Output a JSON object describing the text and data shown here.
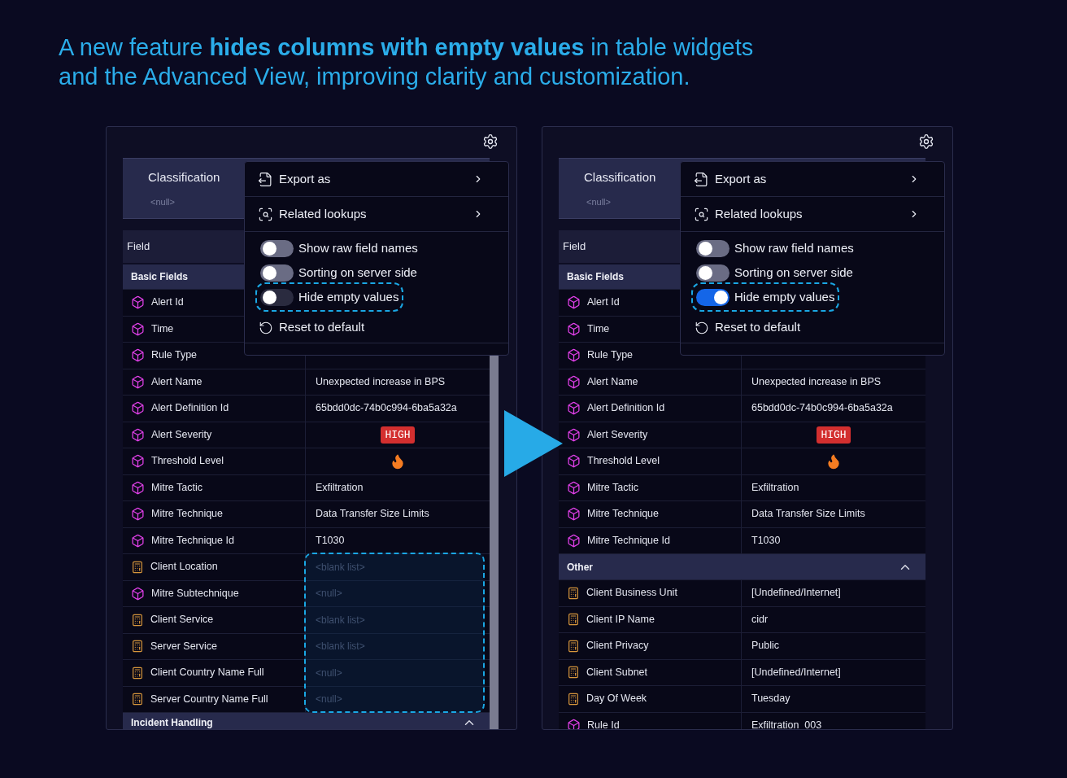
{
  "headline_lines": [
    "A new feature **hides columns with empty values** in table widgets",
    "and the Advanced View, improving clarity and customization."
  ],
  "panels": [
    {
      "header": {
        "title": "Classification",
        "value": "<null>"
      },
      "column": "Field",
      "scrollbar": true,
      "empty_values_highlighted": true,
      "menu": [
        {
          "kind": "export",
          "label": "Export as"
        },
        {
          "kind": "lookups",
          "label": "Related lookups"
        },
        {
          "kind": "toggle",
          "label": "Show raw field names",
          "on": false,
          "highlighted": false
        },
        {
          "kind": "toggle",
          "label": "Sorting on server side",
          "on": false,
          "highlighted": false
        },
        {
          "kind": "toggle",
          "label": "Hide empty values",
          "on": false,
          "highlighted": true
        },
        {
          "kind": "reset",
          "label": "Reset to default"
        }
      ],
      "groups": [
        {
          "title": "Basic Fields",
          "rows": [
            {
              "field": "Alert Id",
              "kind": "native"
            },
            {
              "field": "Time",
              "kind": "native"
            },
            {
              "field": "Rule Type",
              "kind": "native"
            },
            {
              "field": "Alert Name",
              "kind": "native",
              "value": {
                "kind": "text",
                "text": "Unexpected increase in BPS"
              }
            },
            {
              "field": "Alert Definition Id",
              "kind": "native",
              "value": {
                "kind": "text",
                "text": "65bdd0dc-74b0c994-6ba5a32a"
              }
            },
            {
              "field": "Alert Severity",
              "kind": "native",
              "value": {
                "kind": "badge",
                "text": "HIGH"
              }
            },
            {
              "field": "Threshold Level",
              "kind": "native",
              "value": {
                "kind": "flame"
              }
            },
            {
              "field": "Mitre Tactic",
              "kind": "native",
              "value": {
                "kind": "text",
                "text": "Exfiltration"
              }
            },
            {
              "field": "Mitre Technique",
              "kind": "native",
              "value": {
                "kind": "text",
                "text": "Data Transfer Size Limits"
              }
            },
            {
              "field": "Mitre Technique Id",
              "kind": "native",
              "value": {
                "kind": "text",
                "text": "T1030"
              }
            },
            {
              "field": "Client Location",
              "kind": "calculated",
              "value": {
                "kind": "empty",
                "text": "<blank list>"
              }
            },
            {
              "field": "Mitre Subtechnique",
              "kind": "native",
              "value": {
                "kind": "empty",
                "text": "<null>"
              }
            },
            {
              "field": "Client Service",
              "kind": "calculated",
              "value": {
                "kind": "empty",
                "text": "<blank list>"
              }
            },
            {
              "field": "Server Service",
              "kind": "calculated",
              "value": {
                "kind": "empty",
                "text": "<blank list>"
              }
            },
            {
              "field": "Client Country Name Full",
              "kind": "calculated",
              "value": {
                "kind": "empty",
                "text": "<null>"
              }
            },
            {
              "field": "Server Country Name Full",
              "kind": "calculated",
              "value": {
                "kind": "empty",
                "text": "<null>"
              }
            }
          ]
        },
        {
          "title": "Incident Handling",
          "expanded": true
        }
      ]
    },
    {
      "header": {
        "title": "Classification",
        "value": "<null>"
      },
      "column": "Field",
      "scrollbar": false,
      "empty_values_highlighted": false,
      "menu": [
        {
          "kind": "export",
          "label": "Export as"
        },
        {
          "kind": "lookups",
          "label": "Related lookups"
        },
        {
          "kind": "toggle",
          "label": "Show raw field names",
          "on": false,
          "highlighted": false
        },
        {
          "kind": "toggle",
          "label": "Sorting on server side",
          "on": false,
          "highlighted": false
        },
        {
          "kind": "toggle",
          "label": "Hide empty values",
          "on": true,
          "highlighted": true
        },
        {
          "kind": "reset",
          "label": "Reset to default"
        }
      ],
      "groups": [
        {
          "title": "Basic Fields",
          "rows": [
            {
              "field": "Alert Id",
              "kind": "native"
            },
            {
              "field": "Time",
              "kind": "native"
            },
            {
              "field": "Rule Type",
              "kind": "native"
            },
            {
              "field": "Alert Name",
              "kind": "native",
              "value": {
                "kind": "text",
                "text": "Unexpected increase in BPS"
              }
            },
            {
              "field": "Alert Definition Id",
              "kind": "native",
              "value": {
                "kind": "text",
                "text": "65bdd0dc-74b0c994-6ba5a32a"
              }
            },
            {
              "field": "Alert Severity",
              "kind": "native",
              "value": {
                "kind": "badge",
                "text": "HIGH"
              }
            },
            {
              "field": "Threshold Level",
              "kind": "native",
              "value": {
                "kind": "flame"
              }
            },
            {
              "field": "Mitre Tactic",
              "kind": "native",
              "value": {
                "kind": "text",
                "text": "Exfiltration"
              }
            },
            {
              "field": "Mitre Technique",
              "kind": "native",
              "value": {
                "kind": "text",
                "text": "Data Transfer Size Limits"
              }
            },
            {
              "field": "Mitre Technique Id",
              "kind": "native",
              "value": {
                "kind": "text",
                "text": "T1030"
              }
            }
          ]
        },
        {
          "title": "Other",
          "expanded": true,
          "rows": [
            {
              "field": "Client Business Unit",
              "kind": "calculated",
              "value": {
                "kind": "text",
                "text": "[Undefined/Internet]"
              }
            },
            {
              "field": "Client IP Name",
              "kind": "calculated",
              "value": {
                "kind": "text",
                "text": "cidr"
              }
            },
            {
              "field": "Client Privacy",
              "kind": "calculated",
              "value": {
                "kind": "text",
                "text": "Public"
              }
            },
            {
              "field": "Client Subnet",
              "kind": "calculated",
              "value": {
                "kind": "text",
                "text": "[Undefined/Internet]"
              }
            },
            {
              "field": "Day Of Week",
              "kind": "calculated",
              "value": {
                "kind": "text",
                "text": "Tuesday"
              }
            },
            {
              "field": "Rule Id",
              "kind": "native",
              "value": {
                "kind": "text",
                "text": "Exfiltration_003"
              }
            }
          ]
        }
      ]
    }
  ]
}
